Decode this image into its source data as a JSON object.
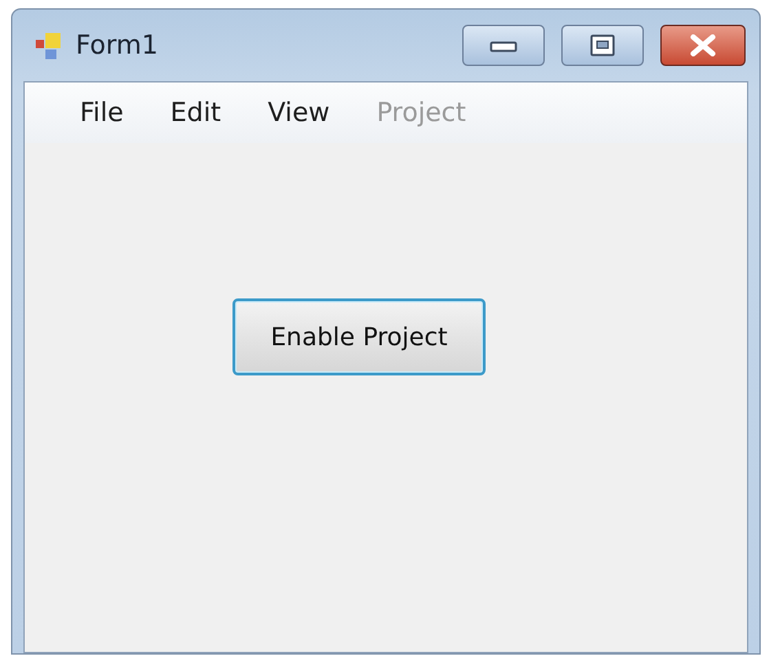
{
  "window": {
    "title": "Form1"
  },
  "menu": [
    {
      "label": "File",
      "disabled": false
    },
    {
      "label": "Edit",
      "disabled": false
    },
    {
      "label": "View",
      "disabled": false
    },
    {
      "label": "Project",
      "disabled": true
    }
  ],
  "button": {
    "label": "Enable Project",
    "focused": true
  }
}
